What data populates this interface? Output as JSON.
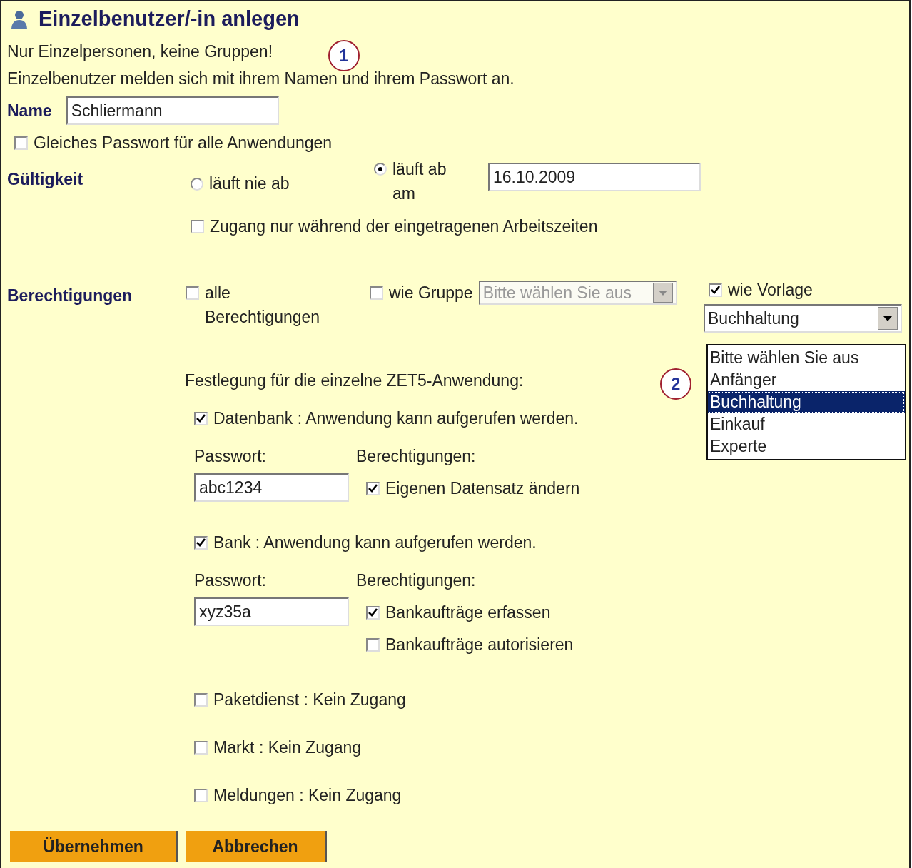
{
  "title": "Einzelbenutzer/-in anlegen",
  "intro": [
    "Nur Einzelpersonen, keine Gruppen!",
    "Einzelbenutzer melden sich mit ihrem Namen und ihrem Passwort an."
  ],
  "callouts": [
    "1",
    "2"
  ],
  "name": {
    "label": "Name",
    "value": "Schliermann"
  },
  "same_password": {
    "label": "Gleiches Passwort für alle Anwendungen",
    "checked": false
  },
  "validity": {
    "label": "Gültigkeit",
    "options": [
      {
        "label": "läuft nie ab",
        "selected": false
      },
      {
        "label": "läuft ab am",
        "selected": true
      }
    ],
    "date": "16.10.2009",
    "working_hours": {
      "label": "Zugang nur während der eingetragenen Arbeitszeiten",
      "checked": false
    }
  },
  "permissions": {
    "label": "Berechtigungen",
    "all": {
      "label": "alle Berechtigungen",
      "checked": false
    },
    "group": {
      "label": "wie Gruppe",
      "checked": false,
      "value": "Bitte wählen Sie aus",
      "disabled": true
    },
    "template": {
      "label": "wie Vorlage",
      "checked": true,
      "value": "Buchhaltung",
      "options": [
        {
          "label": "Bitte wählen Sie aus",
          "selected": false
        },
        {
          "label": "Anfänger",
          "selected": false
        },
        {
          "label": "Buchhaltung",
          "selected": true
        },
        {
          "label": "Einkauf",
          "selected": false
        },
        {
          "label": "Experte",
          "selected": false
        }
      ]
    }
  },
  "apps_heading": "Festlegung für die einzelne ZET5-Anwendung:",
  "apps": [
    {
      "label": "Datenbank : Anwendung kann aufgerufen werden.",
      "checked": true,
      "password_label": "Passwort:",
      "password": "abc1234",
      "rights_label": "Berechtigungen:",
      "rights": [
        {
          "label": "Eigenen Datensatz ändern",
          "checked": true
        }
      ]
    },
    {
      "label": "Bank : Anwendung kann aufgerufen werden.",
      "checked": true,
      "password_label": "Passwort:",
      "password": "xyz35a",
      "rights_label": "Berechtigungen:",
      "rights": [
        {
          "label": "Bankaufträge erfassen",
          "checked": true
        },
        {
          "label": "Bankaufträge autorisieren",
          "checked": false
        }
      ]
    },
    {
      "label": "Paketdienst : Kein Zugang",
      "checked": false
    },
    {
      "label": "Markt : Kein Zugang",
      "checked": false
    },
    {
      "label": "Meldungen : Kein Zugang",
      "checked": false
    }
  ],
  "buttons": [
    "Übernehmen",
    "Abbrechen"
  ]
}
